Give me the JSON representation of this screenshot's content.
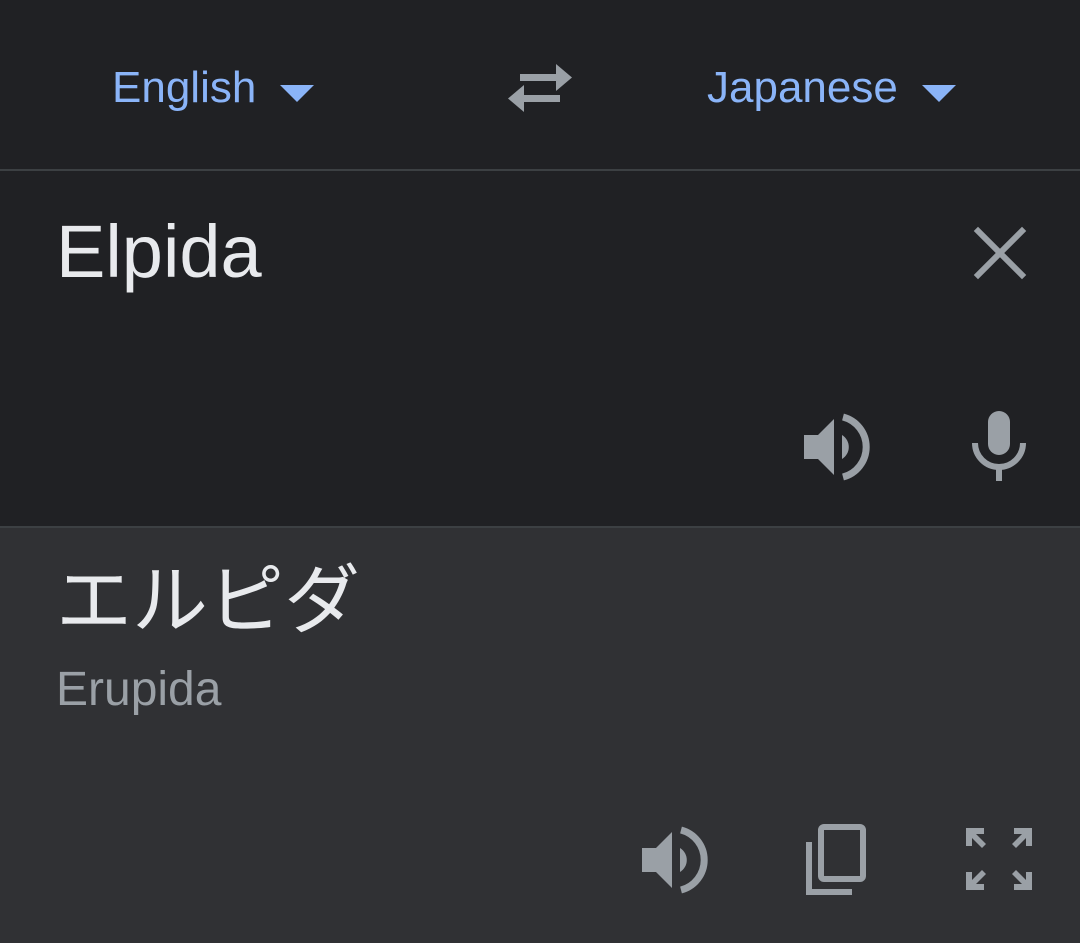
{
  "colors": {
    "background": "#202124",
    "output_background": "#303134",
    "accent": "#8ab4f8",
    "text_primary": "#e8eaed",
    "text_secondary": "#9aa0a6",
    "icon": "#9aa0a6"
  },
  "language_bar": {
    "source_language": "English",
    "target_language": "Japanese",
    "source_caret_icon": "arrow-drop-down-icon",
    "target_caret_icon": "arrow-drop-down-icon",
    "swap_icon": "swap-horiz-icon"
  },
  "input": {
    "text": "Elpida",
    "clear_icon": "close-icon",
    "listen_icon": "volume-up-icon",
    "mic_icon": "mic-icon"
  },
  "output": {
    "translation": "エルピダ",
    "transliteration": "Erupida",
    "listen_icon": "volume-up-icon",
    "copy_icon": "copy-icon",
    "fullscreen_icon": "fullscreen-icon"
  }
}
